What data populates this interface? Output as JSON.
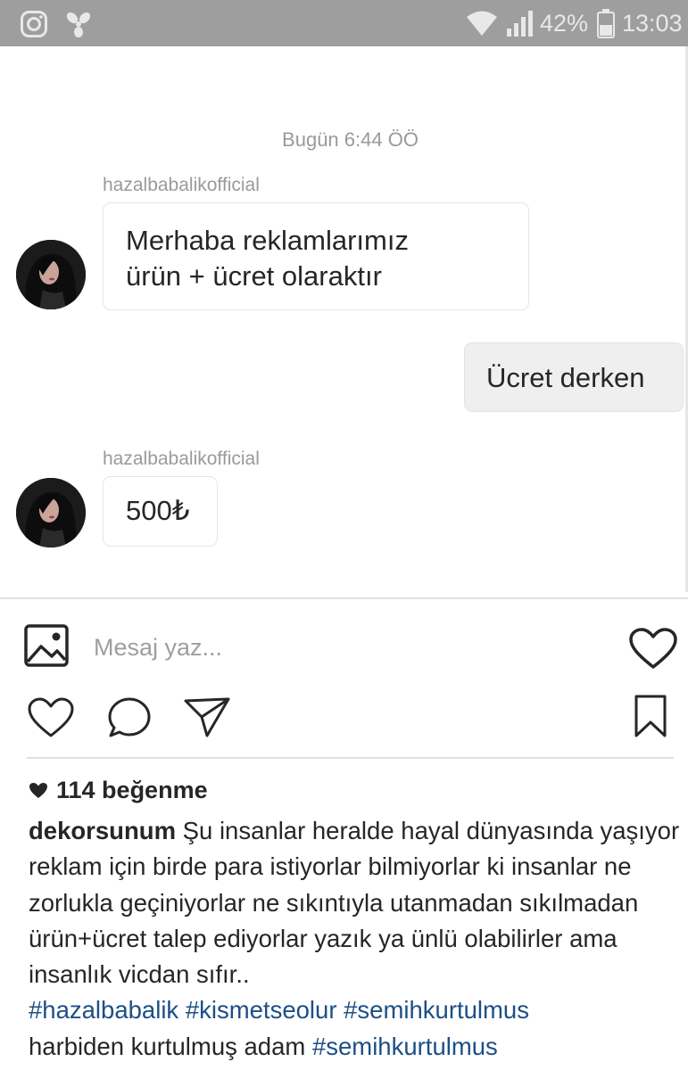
{
  "status_bar": {
    "battery": "42%",
    "time": "13:03"
  },
  "chat": {
    "date_header": "Bugün 6:44 ÖÖ",
    "messages": [
      {
        "direction": "incoming",
        "sender": "hazalbabalikofficial",
        "lines": [
          "Merhaba reklamlarımız",
          "ürün + ücret olaraktır"
        ]
      },
      {
        "direction": "outgoing",
        "text": "Ücret derken"
      },
      {
        "direction": "incoming",
        "sender": "hazalbabalikofficial",
        "text": "500₺"
      }
    ]
  },
  "composer": {
    "placeholder": "Mesaj yaz..."
  },
  "post": {
    "likes": "114 beğenme",
    "caption": {
      "username": "dekorsunum",
      "text": "Şu insanlar heralde hayal dünyasında yaşıyor reklam için birde para istiyorlar bilmiyorlar ki insanlar ne zorlukla geçiniyorlar ne sıkıntıyla utanmadan sıkılmadan ürün+ücret talep ediyorlar yazık ya ünlü olabilirler ama insanlık vicdan sıfır..",
      "hashtags": [
        "#hazalbabalik",
        "#kismetseolur",
        "#semihkurtulmus"
      ],
      "tail_text": "harbiden kurtulmuş adam",
      "tail_hashtag": "#semihkurtulmus"
    }
  },
  "icons": {
    "status_left": [
      "instagram-icon",
      "fan-icon"
    ],
    "status_right": [
      "wifi-icon",
      "signal-icon",
      "battery-icon"
    ],
    "composer": [
      "gallery-icon",
      "heart-outline-icon"
    ],
    "actions": [
      "like-icon",
      "comment-icon",
      "share-icon",
      "bookmark-icon"
    ]
  },
  "colors": {
    "status_bar": "#9e9e9e",
    "hashtag": "#1d4f86",
    "outgoing_bubble": "#efefef"
  }
}
